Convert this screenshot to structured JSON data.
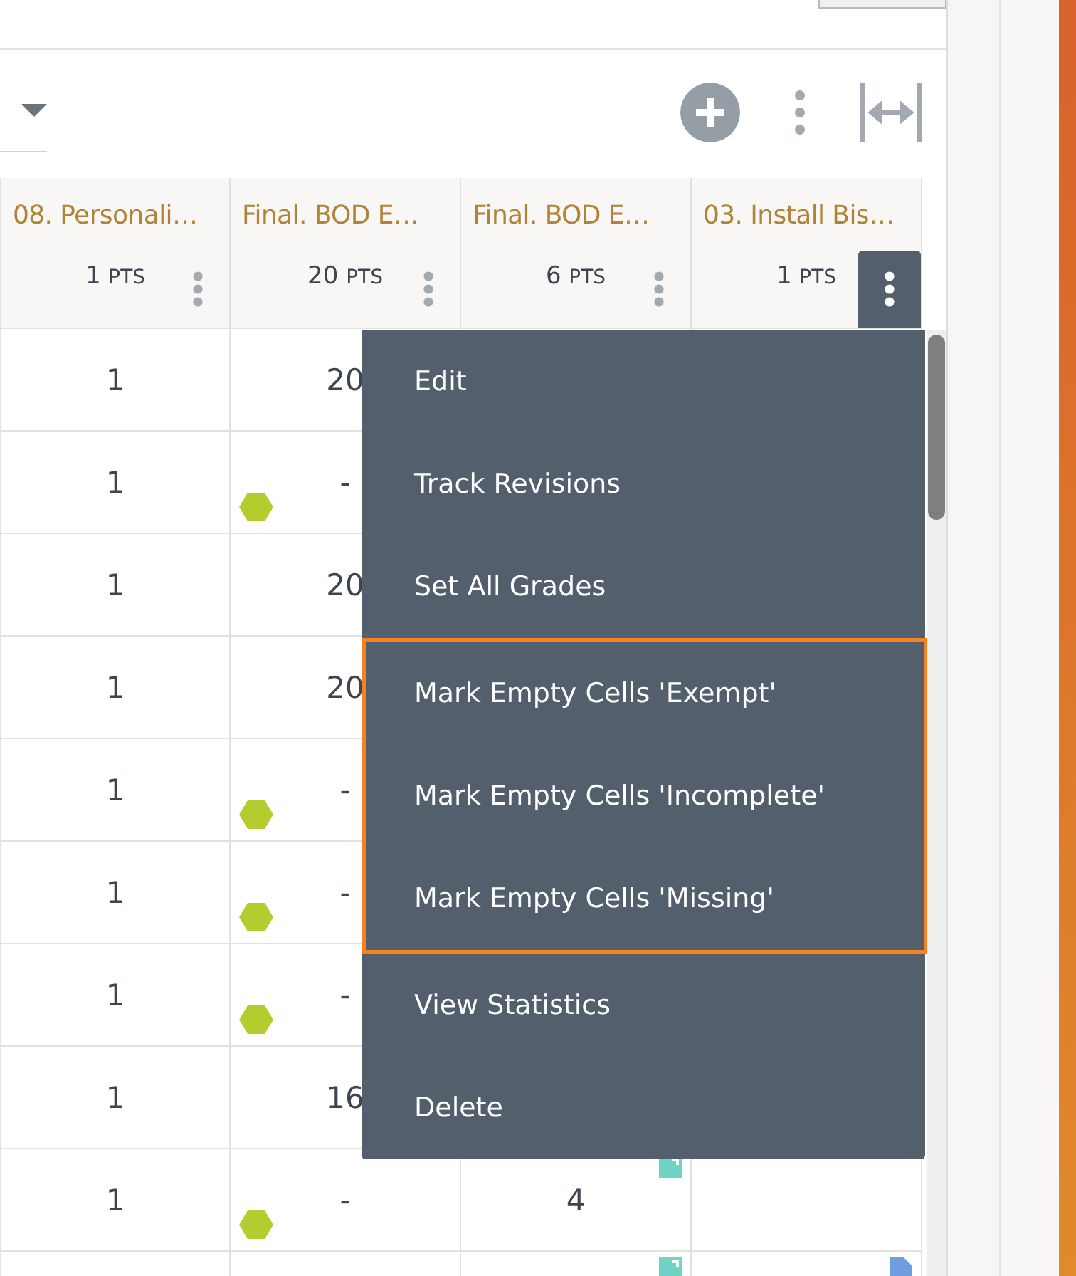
{
  "table": {
    "columns": [
      {
        "title": "08. Personali…",
        "points": "1",
        "unit": "PTS",
        "menu_open": false
      },
      {
        "title": "Final. BOD E…",
        "points": "20",
        "unit": "PTS",
        "menu_open": false
      },
      {
        "title": "Final. BOD E…",
        "points": "6",
        "unit": "PTS",
        "menu_open": false
      },
      {
        "title": "03. Install Bis…",
        "points": "1",
        "unit": "PTS",
        "menu_open": true
      }
    ],
    "rows": [
      {
        "cells": [
          {
            "value": "1"
          },
          {
            "value": "20"
          },
          {},
          {}
        ]
      },
      {
        "cells": [
          {
            "value": "1"
          },
          {
            "value": "-",
            "flagged": true
          },
          {},
          {}
        ]
      },
      {
        "cells": [
          {
            "value": "1"
          },
          {
            "value": "20"
          },
          {},
          {}
        ]
      },
      {
        "cells": [
          {
            "value": "1"
          },
          {
            "value": "20"
          },
          {},
          {}
        ]
      },
      {
        "cells": [
          {
            "value": "1"
          },
          {
            "value": "-",
            "flagged": true
          },
          {},
          {}
        ]
      },
      {
        "cells": [
          {
            "value": "1"
          },
          {
            "value": "-",
            "flagged": true
          },
          {},
          {}
        ]
      },
      {
        "cells": [
          {
            "value": "1"
          },
          {
            "value": "-",
            "flagged": true
          },
          {},
          {}
        ]
      },
      {
        "cells": [
          {
            "value": "1"
          },
          {
            "value": "16"
          },
          {},
          {}
        ]
      },
      {
        "cells": [
          {
            "value": "1"
          },
          {
            "value": "-",
            "flagged": true
          },
          {
            "value": "4",
            "has_note": true
          },
          {}
        ]
      },
      {
        "cells": [
          {},
          {},
          {
            "has_note": true
          },
          {
            "has_attachment": true
          }
        ]
      }
    ]
  },
  "column_menu": {
    "sections": [
      {
        "highlighted": false,
        "items": [
          "Edit",
          "Track Revisions",
          "Set All Grades"
        ]
      },
      {
        "highlighted": true,
        "items": [
          "Mark Empty Cells 'Exempt'",
          "Mark Empty Cells 'Incomplete'",
          "Mark Empty Cells 'Missing'"
        ]
      },
      {
        "highlighted": false,
        "items": [
          "View Statistics",
          "Delete"
        ]
      }
    ]
  }
}
